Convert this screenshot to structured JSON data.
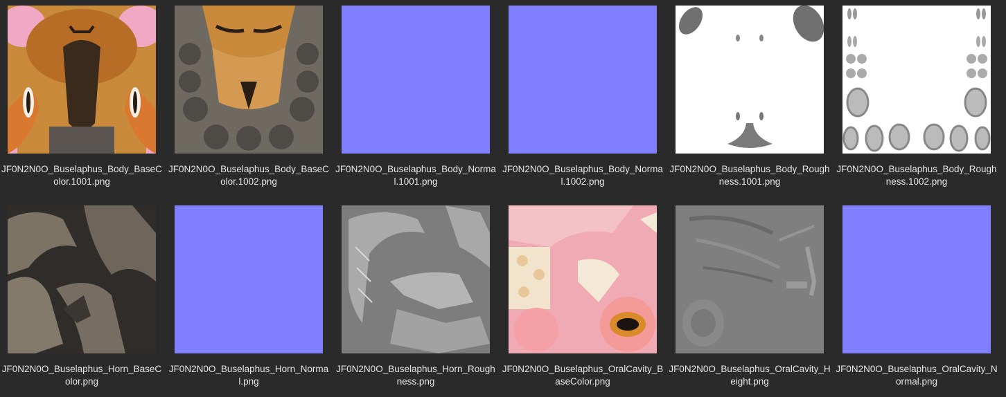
{
  "files": [
    {
      "line1": "JF0N2N0O_Buselaphus_Body_BaseC",
      "line2": "olor.1001.png",
      "kind": "body-basecolor-1",
      "icon": "texture-thumbnail"
    },
    {
      "line1": "JF0N2N0O_Buselaphus_Body_BaseC",
      "line2": "olor.1002.png",
      "kind": "body-basecolor-2",
      "icon": "texture-thumbnail"
    },
    {
      "line1": "JF0N2N0O_Buselaphus_Body_Norma",
      "line2": "l.1001.png",
      "kind": "normal",
      "icon": "texture-thumbnail"
    },
    {
      "line1": "JF0N2N0O_Buselaphus_Body_Norma",
      "line2": "l.1002.png",
      "kind": "normal",
      "icon": "texture-thumbnail"
    },
    {
      "line1": "JF0N2N0O_Buselaphus_Body_Rough",
      "line2": "ness.1001.png",
      "kind": "body-roughness-1",
      "icon": "texture-thumbnail"
    },
    {
      "line1": "JF0N2N0O_Buselaphus_Body_Rough",
      "line2": "ness.1002.png",
      "kind": "body-roughness-2",
      "icon": "texture-thumbnail"
    },
    {
      "line1": "JF0N2N0O_Buselaphus_Horn_BaseC",
      "line2": "olor.png",
      "kind": "horn-basecolor",
      "icon": "texture-thumbnail"
    },
    {
      "line1": "JF0N2N0O_Buselaphus_Horn_Norma",
      "line2": "l.png",
      "kind": "normal",
      "icon": "texture-thumbnail"
    },
    {
      "line1": "JF0N2N0O_Buselaphus_Horn_Rough",
      "line2": "ness.png",
      "kind": "horn-roughness",
      "icon": "texture-thumbnail"
    },
    {
      "line1": "JF0N2N0O_Buselaphus_OralCavity_B",
      "line2": "aseColor.png",
      "kind": "oral-basecolor",
      "icon": "texture-thumbnail"
    },
    {
      "line1": "JF0N2N0O_Buselaphus_OralCavity_H",
      "line2": "eight.png",
      "kind": "oral-height",
      "icon": "texture-thumbnail"
    },
    {
      "line1": "JF0N2N0O_Buselaphus_OralCavity_N",
      "line2": "ormal.png",
      "kind": "normal",
      "icon": "texture-thumbnail"
    }
  ],
  "colors": {
    "background": "#2b2a2a",
    "normal_map": "#7f7fff",
    "label_text": "#e6e6e6",
    "roughness_gray": "#808080"
  }
}
